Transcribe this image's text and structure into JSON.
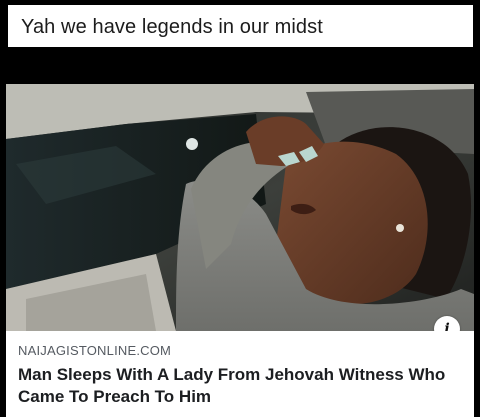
{
  "post": {
    "caption": "Yah we have legends in our midst"
  },
  "link_preview": {
    "domain": "NAIJAGISTONLINE.COM",
    "headline": "Man Sleeps With A Lady From Jehovah Witness Who Came To Preach To Him",
    "info_icon": "i"
  }
}
